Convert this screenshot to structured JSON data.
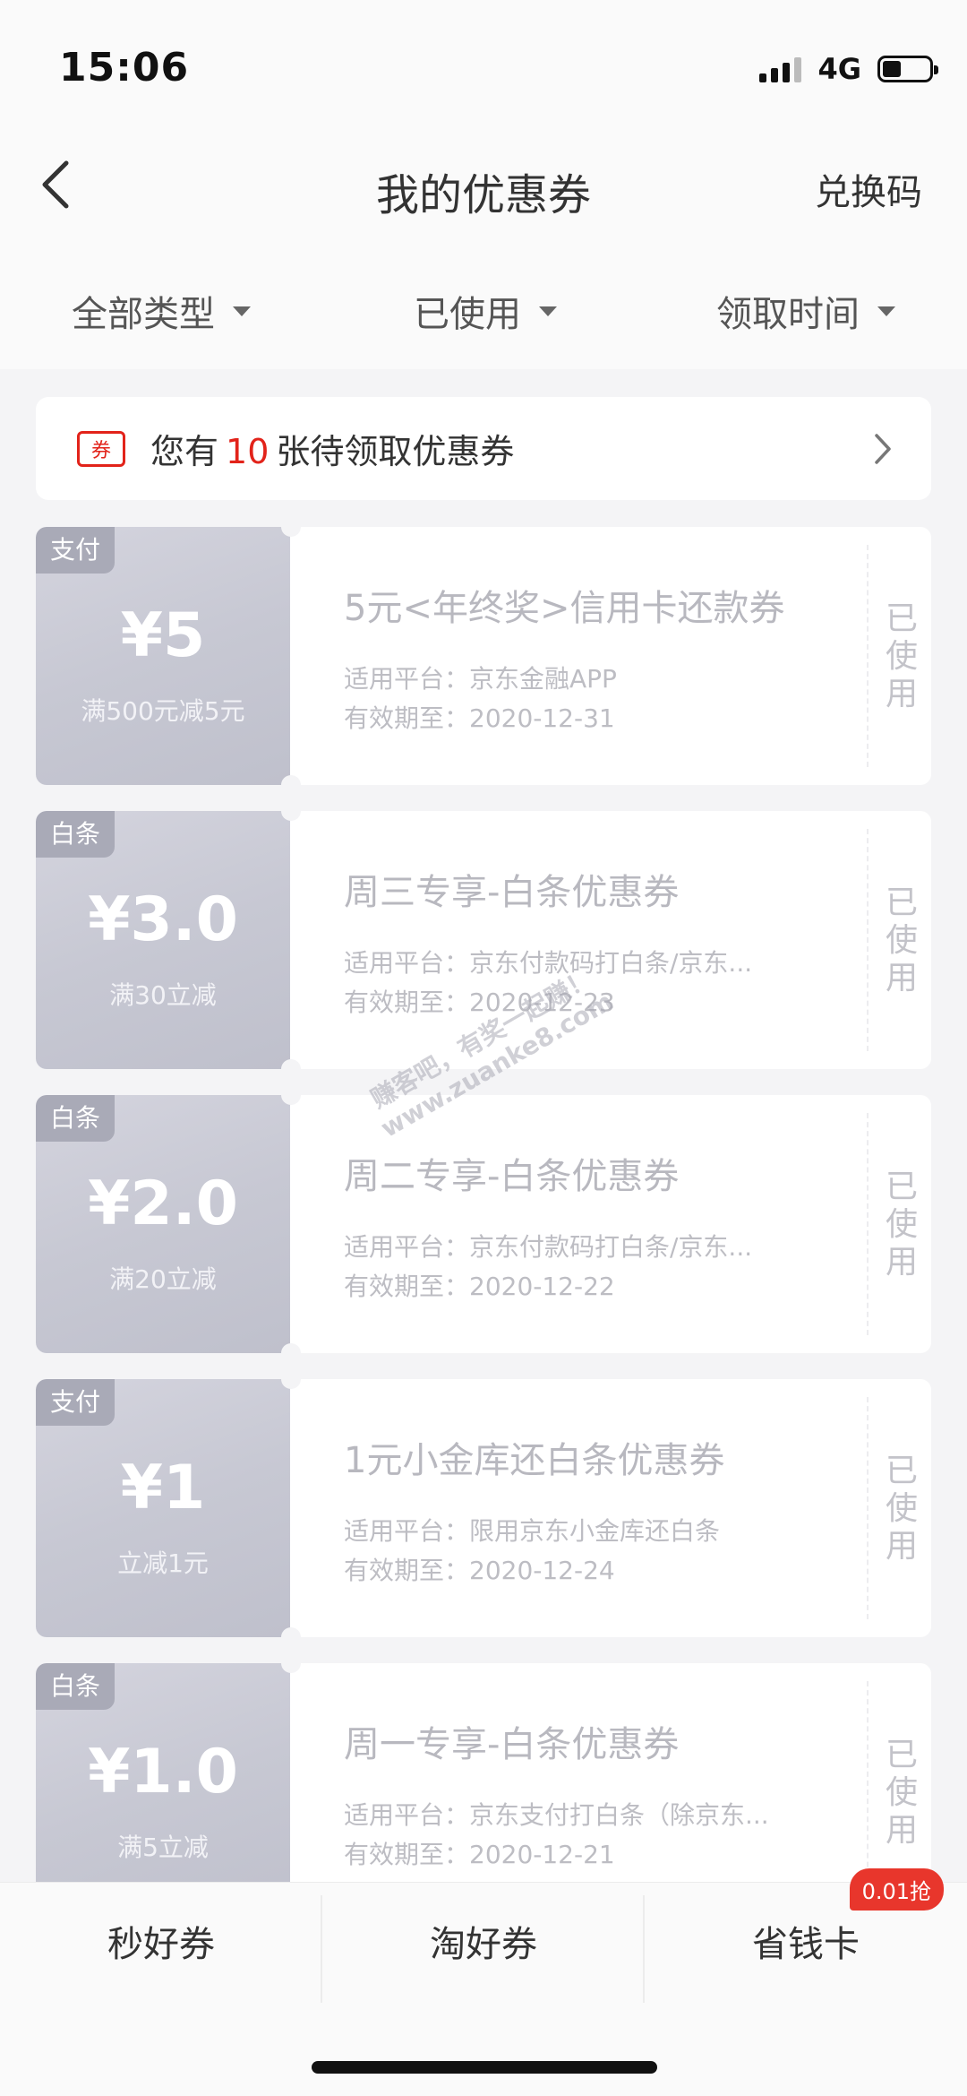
{
  "status": {
    "time": "15:06",
    "network": "4G"
  },
  "nav": {
    "title": "我的优惠券",
    "right": "兑换码"
  },
  "filters": [
    {
      "label": "全部类型"
    },
    {
      "label": "已使用"
    },
    {
      "label": "领取时间"
    }
  ],
  "notice": {
    "icon_text": "券",
    "prefix": "您有",
    "count": "10",
    "suffix": "张待领取优惠券"
  },
  "coupons": [
    {
      "tag": "支付",
      "amount": "¥5",
      "condition": "满500元减5元",
      "name": "5元<年终奖>信用卡还款券",
      "platform": "适用平台：京东金融APP",
      "expire": "有效期至：2020-12-31",
      "status": "已使用"
    },
    {
      "tag": "白条",
      "amount": "¥3.0",
      "condition": "满30立减",
      "name": "周三专享-白条优惠券",
      "platform": "适用平台：京东付款码打白条/京东...",
      "expire": "有效期至：2020-12-23",
      "status": "已使用"
    },
    {
      "tag": "白条",
      "amount": "¥2.0",
      "condition": "满20立减",
      "name": "周二专享-白条优惠券",
      "platform": "适用平台：京东付款码打白条/京东...",
      "expire": "有效期至：2020-12-22",
      "status": "已使用"
    },
    {
      "tag": "支付",
      "amount": "¥1",
      "condition": "立减1元",
      "name": "1元小金库还白条优惠券",
      "platform": "适用平台：限用京东小金库还白条",
      "expire": "有效期至：2020-12-24",
      "status": "已使用"
    },
    {
      "tag": "白条",
      "amount": "¥1.0",
      "condition": "满5立减",
      "name": "周一专享-白条优惠券",
      "platform": "适用平台：京东支付打白条（除京东...",
      "expire": "有效期至：2020-12-21",
      "status": "已使用"
    }
  ],
  "watermark": {
    "line1": "赚客吧，有奖一起赚！",
    "line2": "www.zuanke8.com"
  },
  "bottom_tabs": [
    {
      "label": "秒好券"
    },
    {
      "label": "淘好券"
    },
    {
      "label": "省钱卡",
      "badge": "0.01抢"
    }
  ]
}
